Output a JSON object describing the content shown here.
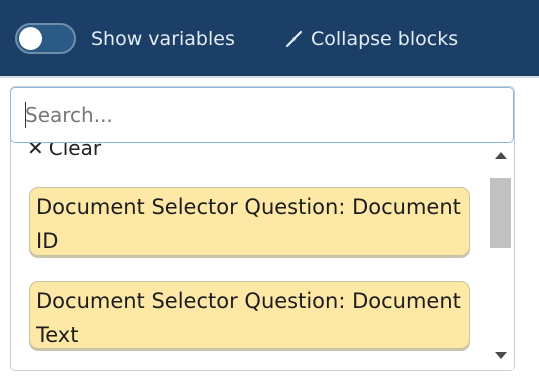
{
  "toolbar": {
    "show_variables_label": "Show variables",
    "show_variables_on": false,
    "collapse_label": "Collapse blocks",
    "collapse_icon": "collapse-arrows-icon"
  },
  "search": {
    "placeholder": "Search...",
    "value": ""
  },
  "dropdown": {
    "clear_label": "Clear",
    "clear_icon": "close-icon",
    "options": [
      "Document Selector Question: Document ID",
      "Document Selector Question: Document Text"
    ]
  },
  "colors": {
    "toolbar_bg": "#1b3f66",
    "chip_bg": "#fde8a5",
    "input_border": "#8eb7dc"
  }
}
